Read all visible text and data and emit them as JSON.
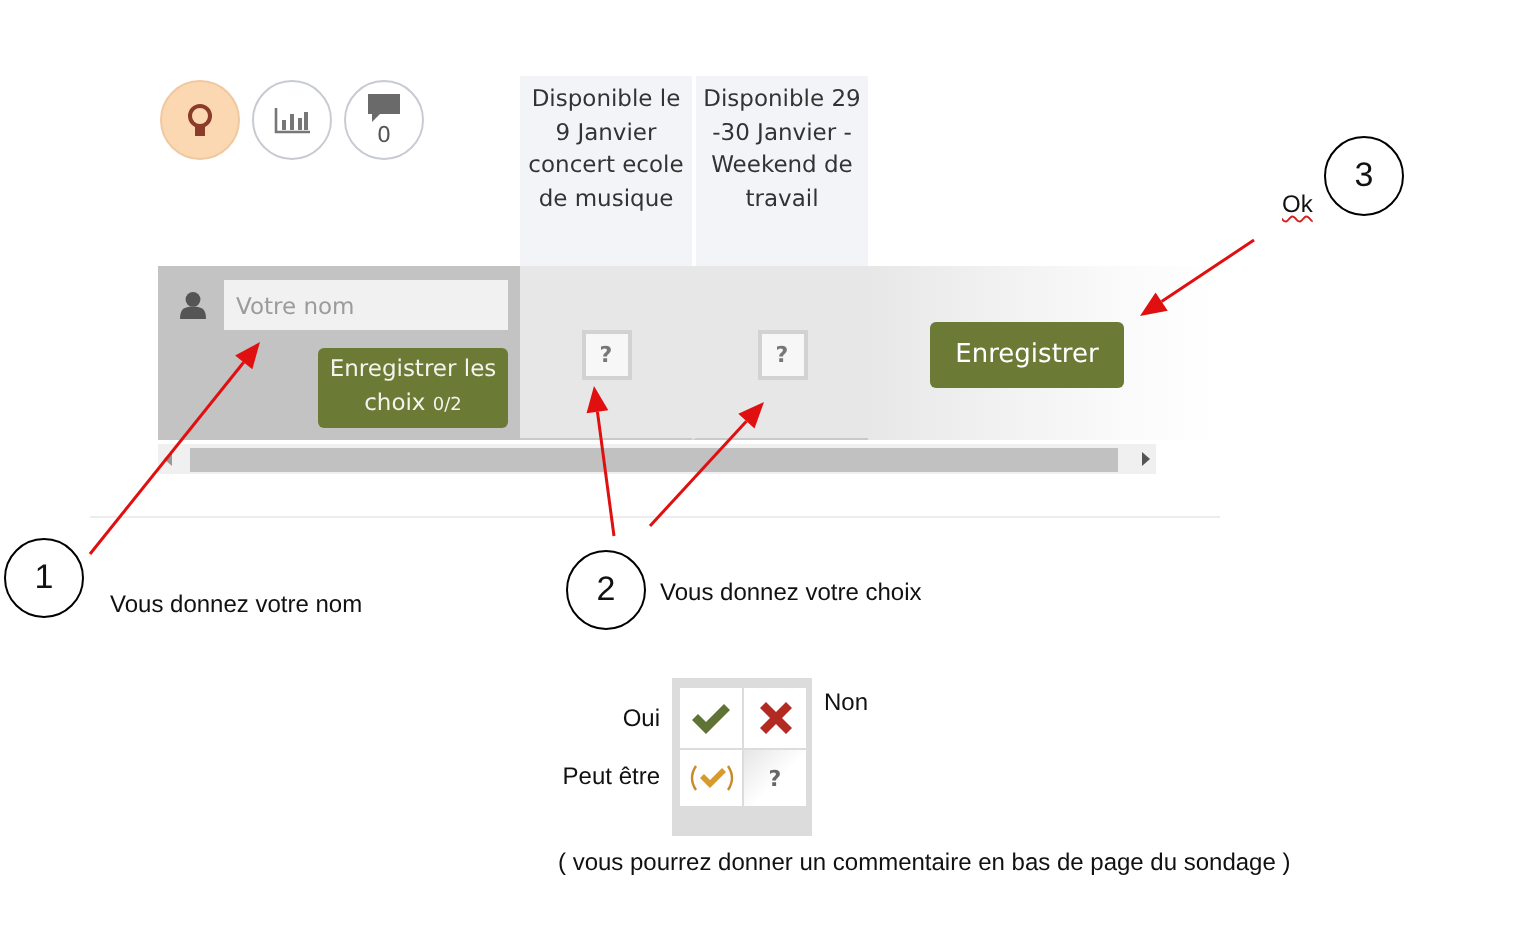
{
  "toolbar": [
    {
      "kind": "idea",
      "selected": true
    },
    {
      "kind": "chart",
      "selected": false
    },
    {
      "kind": "comments",
      "selected": false,
      "count": "0"
    }
  ],
  "poll": {
    "columns": [
      {
        "label": "Disponible le 9 Janvier concert ecole de musique",
        "choice": "?"
      },
      {
        "label": "Disponible 29 -30 Janvier - Weekend de travail",
        "choice": "?"
      }
    ],
    "name_field": {
      "placeholder": "Votre nom"
    },
    "save_choices_button": {
      "label": "Enregistrer les choix",
      "count": "0/2"
    },
    "save_button": {
      "label": "Enregistrer"
    }
  },
  "annotations": [
    {
      "number": "1",
      "text": "Vous donnez votre nom"
    },
    {
      "number": "2",
      "text": "Vous donnez votre choix"
    },
    {
      "number": "3",
      "text": "Ok"
    }
  ],
  "legend": {
    "items": [
      {
        "kind": "yes",
        "label": "Oui"
      },
      {
        "kind": "no",
        "label": "Non"
      },
      {
        "kind": "maybe",
        "label": "Peut être"
      },
      {
        "kind": "unknown",
        "label": "?"
      }
    ],
    "note": "( vous pourrez donner un commentaire en bas de page du sondage )"
  }
}
